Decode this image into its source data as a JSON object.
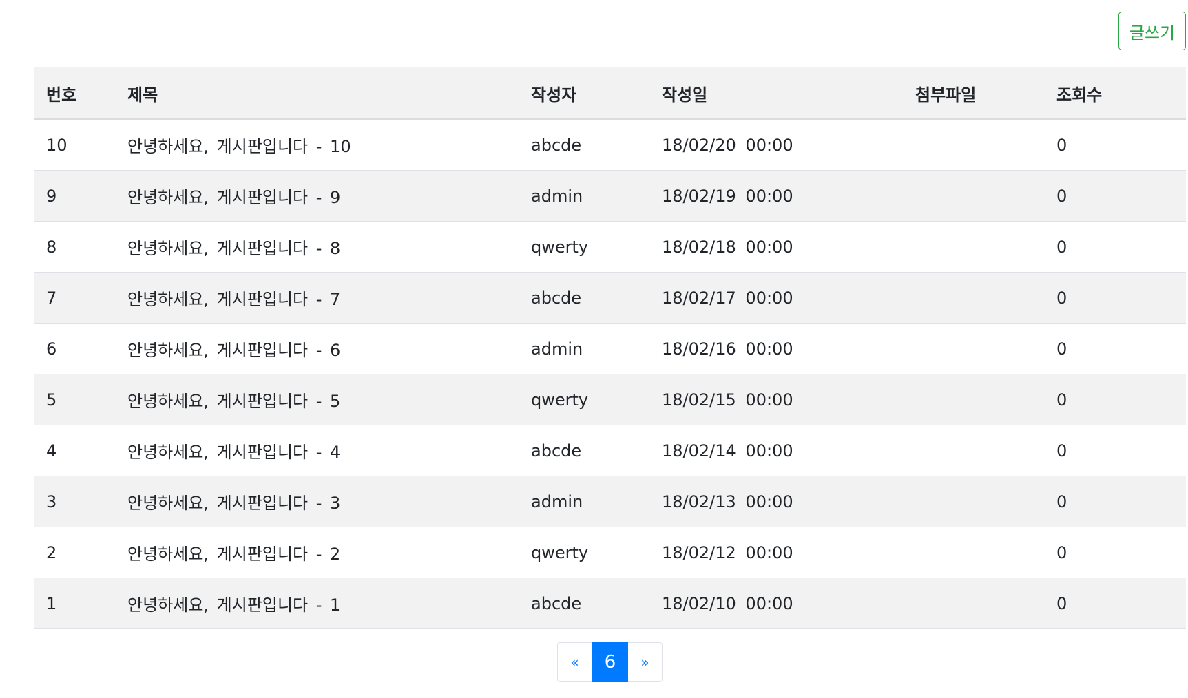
{
  "toolbar": {
    "write_label": "글쓰기"
  },
  "table": {
    "headers": {
      "no": "번호",
      "title": "제목",
      "writer": "작성자",
      "date": "작성일",
      "file": "첨부파일",
      "views": "조회수"
    },
    "rows": [
      {
        "no": "10",
        "title": "안녕하세요, 게시판입니다 - 10",
        "writer": "abcde",
        "date": "18/02/20 00:00",
        "file": "",
        "views": "0"
      },
      {
        "no": "9",
        "title": "안녕하세요, 게시판입니다 - 9",
        "writer": "admin",
        "date": "18/02/19 00:00",
        "file": "",
        "views": "0"
      },
      {
        "no": "8",
        "title": "안녕하세요, 게시판입니다 - 8",
        "writer": "qwerty",
        "date": "18/02/18 00:00",
        "file": "",
        "views": "0"
      },
      {
        "no": "7",
        "title": "안녕하세요, 게시판입니다 - 7",
        "writer": "abcde",
        "date": "18/02/17 00:00",
        "file": "",
        "views": "0"
      },
      {
        "no": "6",
        "title": "안녕하세요, 게시판입니다 - 6",
        "writer": "admin",
        "date": "18/02/16 00:00",
        "file": "",
        "views": "0"
      },
      {
        "no": "5",
        "title": "안녕하세요, 게시판입니다 - 5",
        "writer": "qwerty",
        "date": "18/02/15 00:00",
        "file": "",
        "views": "0"
      },
      {
        "no": "4",
        "title": "안녕하세요, 게시판입니다 - 4",
        "writer": "abcde",
        "date": "18/02/14 00:00",
        "file": "",
        "views": "0"
      },
      {
        "no": "3",
        "title": "안녕하세요, 게시판입니다 - 3",
        "writer": "admin",
        "date": "18/02/13 00:00",
        "file": "",
        "views": "0"
      },
      {
        "no": "2",
        "title": "안녕하세요, 게시판입니다 - 2",
        "writer": "qwerty",
        "date": "18/02/12 00:00",
        "file": "",
        "views": "0"
      },
      {
        "no": "1",
        "title": "안녕하세요, 게시판입니다 - 1",
        "writer": "abcde",
        "date": "18/02/10 00:00",
        "file": "",
        "views": "0"
      }
    ]
  },
  "pagination": {
    "prev_label": "«",
    "current_page": "6",
    "next_label": "»"
  },
  "colors": {
    "write_button": "#28a745",
    "pagination_active": "#007bff",
    "row_stripe": "#f2f2f2"
  }
}
